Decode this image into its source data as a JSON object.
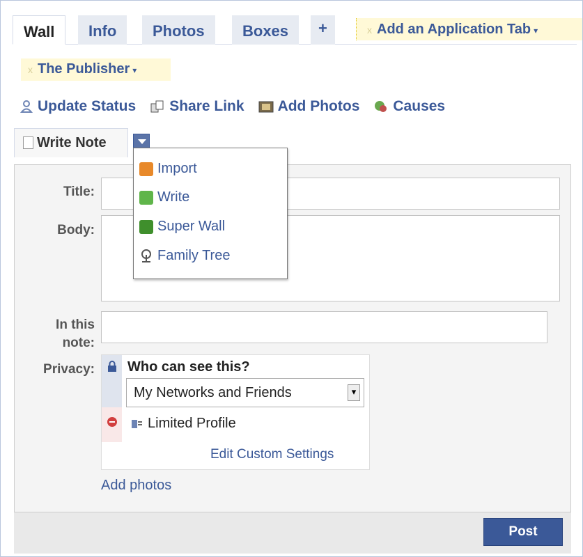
{
  "tabs": [
    {
      "label": "Wall",
      "active": true
    },
    {
      "label": "Info"
    },
    {
      "label": "Photos"
    },
    {
      "label": "Boxes"
    }
  ],
  "tab_add": "+",
  "app_tab": {
    "label": "Add an Application Tab",
    "close": "x",
    "caret": "▾"
  },
  "publisher": {
    "label": "The Publisher",
    "close": "x",
    "caret": "▾"
  },
  "actions": [
    {
      "label": "Update Status",
      "icon": "person-icon"
    },
    {
      "label": "Share Link",
      "icon": "share-link-icon"
    },
    {
      "label": "Add Photos",
      "icon": "photo-icon"
    },
    {
      "label": "Causes",
      "icon": "causes-icon"
    }
  ],
  "write_note": {
    "label": "Write Note"
  },
  "menu": [
    {
      "label": "Import",
      "icon": "rss-icon",
      "color": "#e8892a"
    },
    {
      "label": "Write",
      "icon": "speech-bubble-icon",
      "color": "#5fb54a"
    },
    {
      "label": "Super Wall",
      "icon": "superwall-icon",
      "color": "#3f8f2c"
    },
    {
      "label": "Family Tree",
      "icon": "tree-icon",
      "color": "#555555"
    }
  ],
  "form": {
    "title_label": "Title:",
    "body_label": "Body:",
    "in_this_label_1": "In this",
    "in_this_label_2": "note:",
    "privacy_label": "Privacy:",
    "who_can_see": "Who can see this?",
    "privacy_value": "My Networks and Friends",
    "limited_profile": "Limited Profile",
    "edit_custom": "Edit Custom Settings",
    "add_photos": "Add photos",
    "post": "Post"
  },
  "colors": {
    "link": "#3b5998",
    "app_tab_bg": "#fff9d7",
    "post_bg": "#3b5998"
  }
}
